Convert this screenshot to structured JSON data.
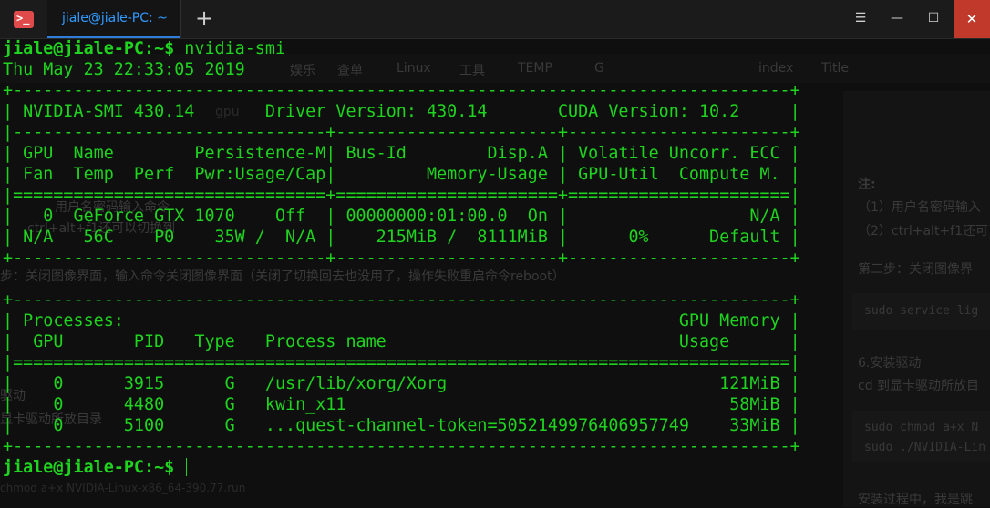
{
  "window": {
    "tab_title": "jiale@jiale-PC: ~",
    "new_tab_symbol": "+",
    "menu_symbol": "☰",
    "minimize_symbol": "—",
    "maximize_symbol": "☐",
    "close_symbol": "✕",
    "app_icon_symbol": ">_",
    "icon_color": "#e04a4a",
    "accent": "#2f9bff"
  },
  "terminal": {
    "text_color": "#1ed41e",
    "prompt": "jiale@jiale-PC:~$",
    "command": " nvidia-smi",
    "lines": [
      "Thu May 23 22:33:05 2019",
      "+-----------------------------------------------------------------------------+",
      "| NVIDIA-SMI 430.14       Driver Version: 430.14       CUDA Version: 10.2     |",
      "|-------------------------------+----------------------+----------------------+",
      "| GPU  Name        Persistence-M| Bus-Id        Disp.A | Volatile Uncorr. ECC |",
      "| Fan  Temp  Perf  Pwr:Usage/Cap|         Memory-Usage | GPU-Util  Compute M. |",
      "|===============================+======================+======================|",
      "|   0  GeForce GTX 1070    Off  | 00000000:01:00.0  On |                  N/A |",
      "| N/A   56C    P0    35W /  N/A |    215MiB /  8111MiB |      0%      Default |",
      "+-------------------------------+----------------------+----------------------+",
      "",
      "+-----------------------------------------------------------------------------+",
      "| Processes:                                                       GPU Memory |",
      "|  GPU       PID   Type   Process name                             Usage      |",
      "|=============================================================================|",
      "|    0      3915      G   /usr/lib/xorg/Xorg                           121MiB |",
      "|    0      4480      G   kwin_x11                                      58MiB |",
      "|    0      5100      G   ...quest-channel-token=5052149976406957749    33MiB |",
      "+-----------------------------------------------------------------------------+"
    ],
    "final_prompt": "jiale@jiale-PC:~$"
  },
  "background_page": {
    "bookmarks": [
      "娱乐",
      "查单",
      "Linux",
      "工具",
      "TEMP",
      "G",
      "index",
      "Title"
    ],
    "title_fragment": "gpu",
    "chinese_line_1": "用户名密码输入命令",
    "chinese_line_2": "ctrl+alt+f1还可以切换到",
    "step_line": "步：关闭图像界面，输入命令关闭图像界面（关闭了切换回去也没用了，操作失败重启命令reboot）",
    "driver_line_1": "驱动",
    "driver_line_2": "显卡驱动所放目录",
    "chmod_line": "chmod a+x NVIDIA-Linux-x86_64-390.77.run",
    "right_note": "注:",
    "right_1": "（1）用户名密码输入",
    "right_2": "（2）ctrl+alt+f1还可",
    "right_step": "第二步：关闭图像界",
    "right_code_1": "sudo service lig",
    "right_install": "6.安装驱动",
    "right_cd": "cd 到显卡驱动所放目",
    "right_code_2": "sudo chmod a+x N",
    "right_code_3": "sudo ./NVIDIA-Lin",
    "right_bottom": "安装过程中，我是跳"
  }
}
